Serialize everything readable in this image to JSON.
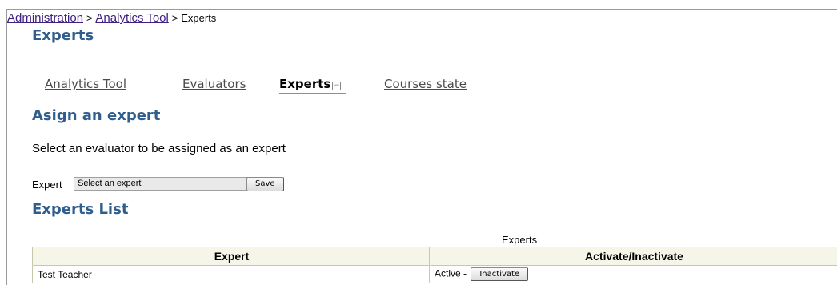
{
  "breadcrumb": {
    "items": [
      "Administration",
      "Analytics Tool"
    ],
    "separator": ">",
    "current": "Experts"
  },
  "page_title": "Experts",
  "tabs": [
    {
      "label": "Analytics Tool",
      "active": false
    },
    {
      "label": "Evaluators",
      "active": false
    },
    {
      "label": "Experts",
      "active": true
    },
    {
      "label": "Courses state",
      "active": false
    }
  ],
  "assign": {
    "title": "Asign an expert",
    "instructions": "Select an evaluator to be assigned as an expert",
    "expert_label": "Expert",
    "select_value": "Select an expert",
    "save_label": "Save"
  },
  "experts_list": {
    "title": "Experts List",
    "caption": "Experts",
    "columns": [
      "Expert",
      "Activate/Inactivate"
    ],
    "rows": [
      {
        "expert": "Test Teacher",
        "status": "Active -",
        "action_label": "Inactivate"
      }
    ]
  },
  "colors": {
    "heading": "#2f5d8c",
    "link": "#3f1f82",
    "active_tab_underline": "#e07a2b",
    "table_header_bg": "#f6f6e8"
  }
}
